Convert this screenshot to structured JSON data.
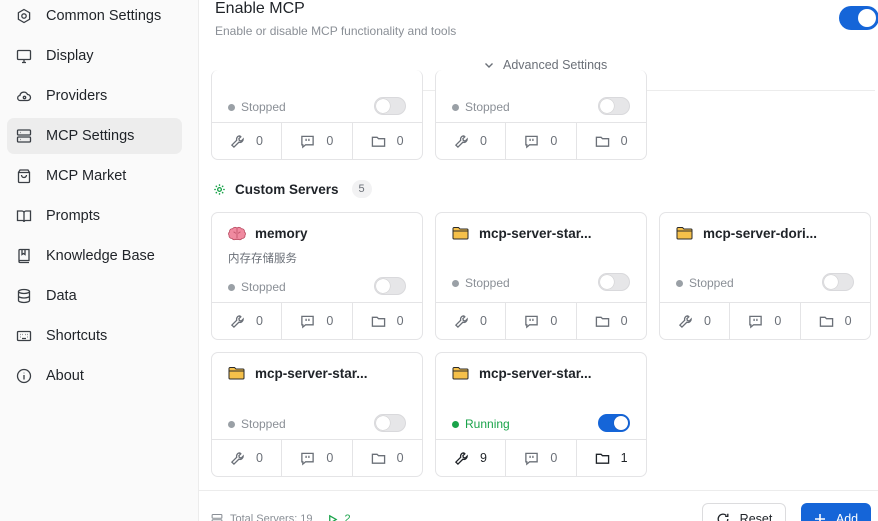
{
  "sidebar": {
    "items": [
      {
        "label": "Common Settings",
        "icon": "gear-icon"
      },
      {
        "label": "Display",
        "icon": "monitor-icon"
      },
      {
        "label": "Providers",
        "icon": "cloud-icon"
      },
      {
        "label": "MCP Settings",
        "icon": "server-icon",
        "active": true
      },
      {
        "label": "MCP Market",
        "icon": "shopping-bag-icon"
      },
      {
        "label": "Prompts",
        "icon": "book-open-icon"
      },
      {
        "label": "Knowledge Base",
        "icon": "book-icon"
      },
      {
        "label": "Data",
        "icon": "database-icon"
      },
      {
        "label": "Shortcuts",
        "icon": "keyboard-icon"
      },
      {
        "label": "About",
        "icon": "info-icon"
      }
    ]
  },
  "header": {
    "title": "Enable MCP",
    "description": "Enable or disable MCP functionality and tools",
    "enabled": true,
    "advanced_label": "Advanced Settings"
  },
  "builtin_cards": [
    {
      "status": "Stopped",
      "tools": "0",
      "prompts": "0",
      "resources": "0"
    },
    {
      "status": "Stopped",
      "tools": "0",
      "prompts": "0",
      "resources": "0"
    }
  ],
  "custom_section": {
    "title": "Custom Servers",
    "count": "5"
  },
  "custom_cards": [
    {
      "name": "memory",
      "icon": "brain-icon",
      "description": "内存存储服务",
      "status": "Stopped",
      "running": false,
      "tools": "0",
      "prompts": "0",
      "resources": "0"
    },
    {
      "name": "mcp-server-star...",
      "icon": "folder-icon",
      "description": "",
      "status": "Stopped",
      "running": false,
      "tools": "0",
      "prompts": "0",
      "resources": "0"
    },
    {
      "name": "mcp-server-dori...",
      "icon": "folder-icon",
      "description": "",
      "status": "Stopped",
      "running": false,
      "tools": "0",
      "prompts": "0",
      "resources": "0"
    },
    {
      "name": "mcp-server-star...",
      "icon": "folder-icon",
      "description": "",
      "status": "Stopped",
      "running": false,
      "tools": "0",
      "prompts": "0",
      "resources": "0"
    },
    {
      "name": "mcp-server-star...",
      "icon": "folder-icon",
      "description": "",
      "status": "Running",
      "running": true,
      "tools": "9",
      "prompts": "0",
      "resources": "1"
    }
  ],
  "bottom": {
    "total_label": "Total Servers: 19",
    "running_count": "2",
    "reset_label": "Reset",
    "add_label": "Add"
  },
  "colors": {
    "accent": "#1565d8",
    "running": "#1aa34a",
    "stopped": "#9aa0a6",
    "folder": "#f5c04a",
    "brain": "#f08aa0"
  }
}
